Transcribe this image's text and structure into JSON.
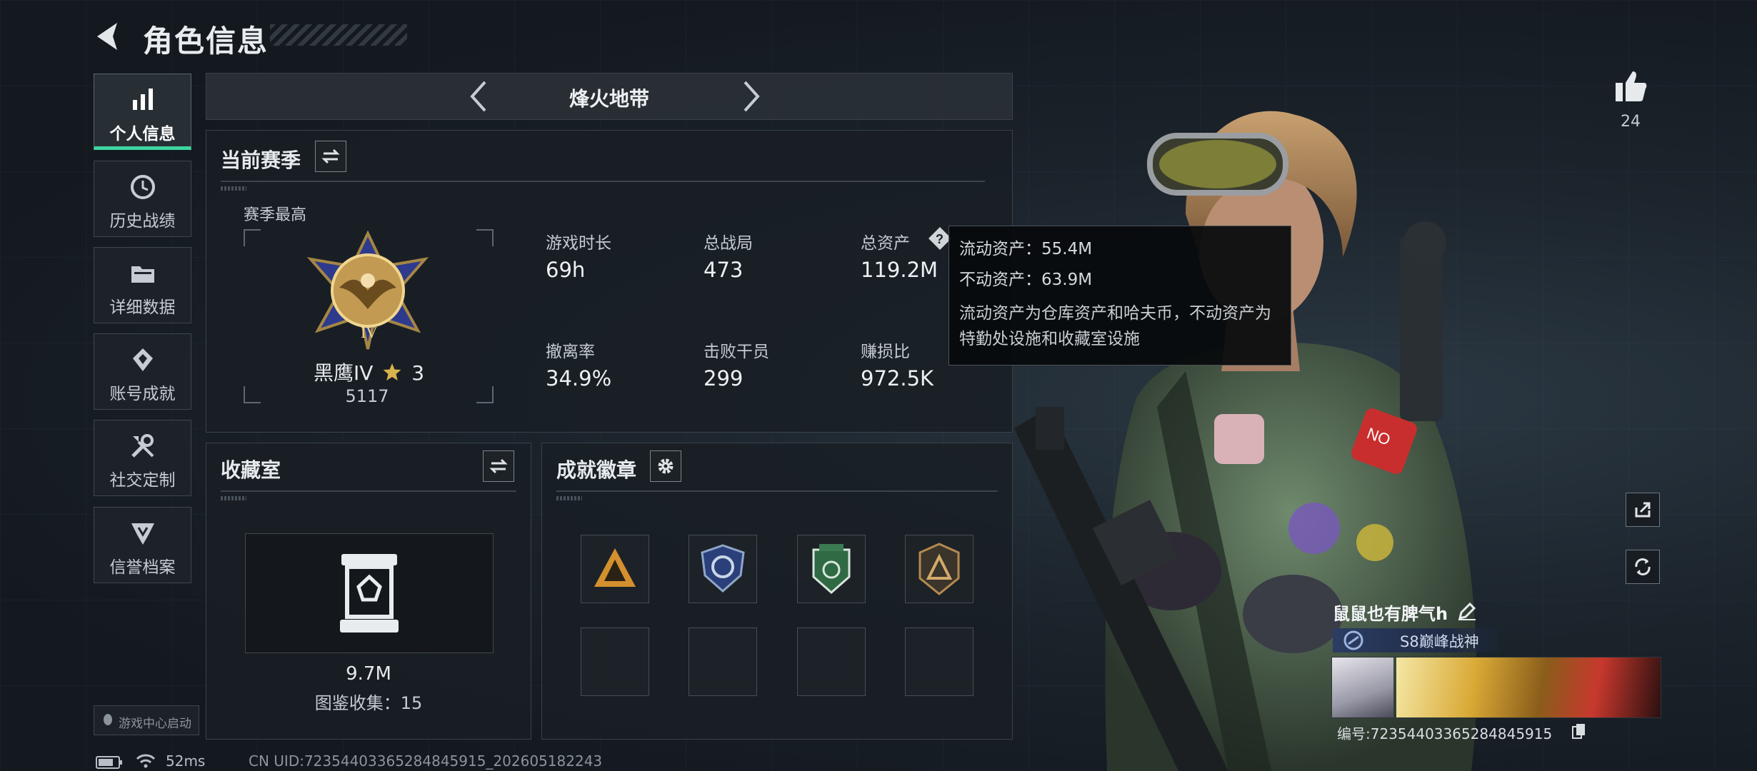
{
  "header": {
    "title": "角色信息"
  },
  "sidebar": {
    "items": [
      {
        "label": "个人信息",
        "icon": "bar-chart-icon",
        "active": true
      },
      {
        "label": "历史战绩",
        "icon": "clock-icon"
      },
      {
        "label": "详细数据",
        "icon": "folder-icon"
      },
      {
        "label": "账号成就",
        "icon": "diamond-badge-icon"
      },
      {
        "label": "社交定制",
        "icon": "tools-icon"
      },
      {
        "label": "信誉档案",
        "icon": "shield-badge-icon"
      }
    ],
    "launch_label": "游戏中心启动"
  },
  "mode": {
    "title": "烽火地带"
  },
  "season": {
    "title": "当前赛季",
    "best_label": "赛季最高",
    "rank_name": "黑鹰IV",
    "rank_stars": "3",
    "rank_points": "5117",
    "stats": [
      {
        "label": "游戏时长",
        "value": "69h"
      },
      {
        "label": "总战局",
        "value": "473"
      },
      {
        "label": "总资产",
        "value": "119.2M"
      },
      {
        "label": "撤离率",
        "value": "34.9%"
      },
      {
        "label": "击败干员",
        "value": "299"
      },
      {
        "label": "赚损比",
        "value": "972.5K"
      }
    ]
  },
  "tooltip": {
    "liquid": "流动资产：55.4M",
    "fixed": "不动资产：63.9M",
    "description": "流动资产为仓库资产和哈夫币，不动资产为特勤处设施和收藏室设施"
  },
  "collection": {
    "title": "收藏室",
    "value": "9.7M",
    "catalog": "图鉴收集：15"
  },
  "badges": {
    "title": "成就徽章",
    "items": [
      "triangle-squad-badge",
      "blue-shield-badge",
      "green-shield-badge",
      "bronze-triangle-badge"
    ]
  },
  "likes": {
    "count": "24"
  },
  "player": {
    "name": "鼠鼠也有脾气h",
    "title": "S8巅峰战神",
    "id": "编号:723544033652848459​15"
  },
  "footer": {
    "ping": "52ms",
    "uid": "CN UID:7235440336528484​5915_202605182243"
  },
  "colors": {
    "accent": "#3ed5a0",
    "panel": "#191e24",
    "tooltip": "#08090b"
  }
}
